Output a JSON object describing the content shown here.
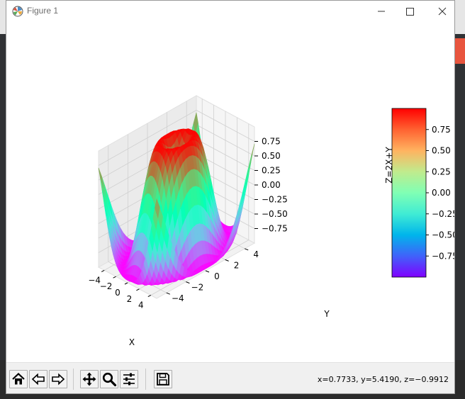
{
  "window": {
    "title": "Figure 1"
  },
  "toolbar": {
    "buttons": [
      {
        "name": "home-button",
        "icon": "home-icon"
      },
      {
        "name": "back-button",
        "icon": "arrow-left-icon"
      },
      {
        "name": "forward-button",
        "icon": "arrow-right-icon"
      },
      {
        "name": "pan-button",
        "icon": "move-icon"
      },
      {
        "name": "zoom-button",
        "icon": "magnifier-icon"
      },
      {
        "name": "configure-subplots-button",
        "icon": "sliders-icon"
      },
      {
        "name": "save-button",
        "icon": "floppy-icon"
      }
    ],
    "status": "x=0.7733, y=5.4190, z=−0.9912"
  },
  "chart_data": {
    "type": "surface3d",
    "function": "sin(sqrt(x^2 + y^2))",
    "colormap": "rainbow",
    "x_range": [
      -5,
      5
    ],
    "y_range": [
      -5,
      5
    ],
    "z_range": [
      -1,
      1
    ],
    "x_ticks": [
      "−4",
      "−2",
      "0",
      "2",
      "4"
    ],
    "y_ticks": [
      "−4",
      "−2",
      "0",
      "2",
      "4"
    ],
    "z_ticks": [
      "−0.75",
      "−0.50",
      "−0.25",
      "0.00",
      "0.25",
      "0.50",
      "0.75"
    ],
    "xlabel": "X",
    "ylabel": "Y",
    "zlabel": "Z=2X+Y",
    "colorbar": {
      "ticks": [
        "0.75",
        "0.50",
        "0.25",
        "0.00",
        "−0.25",
        "−0.50",
        "−0.75"
      ],
      "range": [
        -1,
        1
      ]
    }
  },
  "colors": {
    "accent_red": "#ff0000",
    "accent_violet": "#8000ff"
  }
}
